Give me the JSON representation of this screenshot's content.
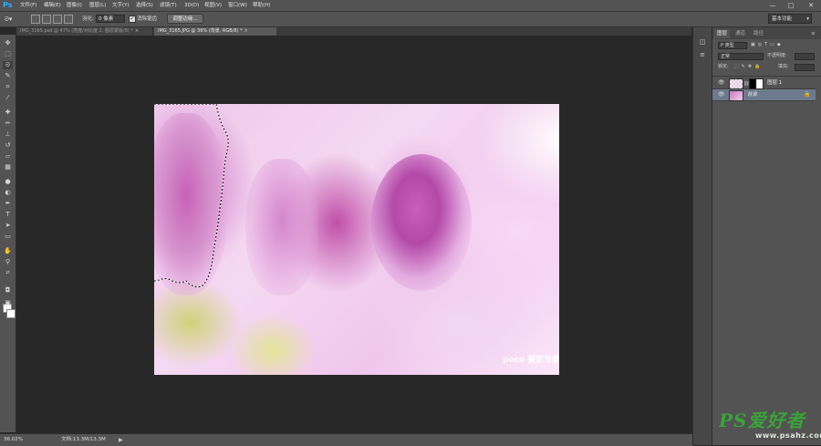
{
  "app": {
    "logo": "Ps"
  },
  "menu": [
    "文件(F)",
    "编辑(E)",
    "图像(I)",
    "图层(L)",
    "文字(Y)",
    "选择(S)",
    "滤镜(T)",
    "3D(D)",
    "视图(V)",
    "窗口(W)",
    "帮助(H)"
  ],
  "window_controls": {
    "minimize": "—",
    "maximize": "□",
    "close": "✕"
  },
  "options": {
    "feather_label": "羽化:",
    "feather_value": "0 像素",
    "antialias_label": "消除锯齿",
    "refine_edge_button": "调整边缘...",
    "workspace": "基本功能"
  },
  "tabs": [
    {
      "label": "IMG_3165.psd @ 47% (亮度/对比度 2, 图层蒙版/8) *",
      "active": false
    },
    {
      "label": "IMG_3165.JPG @ 36% (背景, RGB/8) *",
      "active": true
    }
  ],
  "tools": [
    "move-tool",
    "marquee-tool",
    "lasso-tool",
    "quick-select-tool",
    "crop-tool",
    "eyedropper-tool",
    "healing-tool",
    "brush-tool",
    "stamp-tool",
    "history-brush-tool",
    "eraser-tool",
    "gradient-tool",
    "blur-tool",
    "dodge-tool",
    "pen-tool",
    "type-tool",
    "path-select-tool",
    "shape-tool",
    "hand-tool",
    "zoom-tool"
  ],
  "document": {
    "watermark": "poco 摄影专题"
  },
  "status": {
    "zoom": "36.02%",
    "doc_label": "文档:",
    "doc_size": "13.3M/13.3M",
    "arrow": "▶"
  },
  "panel": {
    "tabs": [
      "图层",
      "通道",
      "路径"
    ],
    "filter_kind": "P 类型",
    "blend_mode": "正常",
    "opacity_label": "不透明度:",
    "lock_label": "锁定:",
    "fill_label": "填充:",
    "layers": [
      {
        "name": "图层 1",
        "selected": false,
        "visible": true,
        "has_mask": true
      },
      {
        "name": "背景",
        "selected": true,
        "visible": true,
        "has_mask": false
      }
    ]
  },
  "site_watermark": {
    "logo": "PS爱好者",
    "url": "www.psahz.com"
  }
}
